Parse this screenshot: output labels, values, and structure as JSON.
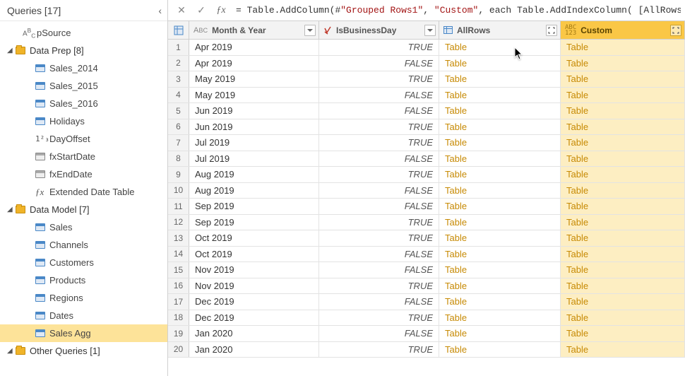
{
  "queries_header": "Queries [17]",
  "tree": {
    "pSource": "pSource",
    "dataPrep": {
      "label": "Data Prep [8]",
      "items": [
        "Sales_2014",
        "Sales_2015",
        "Sales_2016",
        "Holidays",
        "DayOffset",
        "fxStartDate",
        "fxEndDate",
        "Extended Date Table"
      ]
    },
    "dataModel": {
      "label": "Data Model [7]",
      "items": [
        "Sales",
        "Channels",
        "Customers",
        "Products",
        "Regions",
        "Dates",
        "Sales Agg"
      ]
    },
    "otherQueries": {
      "label": "Other Queries [1]"
    }
  },
  "formula": {
    "prefix": "= ",
    "fn1": "Table.AddColumn",
    "open": "(#",
    "arg1": "\"Grouped Rows1\"",
    "sep1": ", ",
    "arg2": "\"Custom\"",
    "sep2": ", ",
    "kw": "each",
    "sp": " ",
    "fn2": "Table.AddIndexColumn",
    "tail": "( [AllRows],"
  },
  "columns": [
    {
      "type": "abc",
      "label": "Month & Year",
      "control": "dd"
    },
    {
      "type": "bool",
      "label": "IsBusinessDay",
      "control": "dd"
    },
    {
      "type": "tbl",
      "label": "AllRows",
      "control": "exp"
    },
    {
      "type": "abc123",
      "label": "Custom",
      "control": "exp",
      "selected": true
    }
  ],
  "rows": [
    {
      "n": 1,
      "my": "Apr 2019",
      "b": "TRUE",
      "a": "Table",
      "c": "Table"
    },
    {
      "n": 2,
      "my": "Apr 2019",
      "b": "FALSE",
      "a": "Table",
      "c": "Table"
    },
    {
      "n": 3,
      "my": "May 2019",
      "b": "TRUE",
      "a": "Table",
      "c": "Table"
    },
    {
      "n": 4,
      "my": "May 2019",
      "b": "FALSE",
      "a": "Table",
      "c": "Table"
    },
    {
      "n": 5,
      "my": "Jun 2019",
      "b": "FALSE",
      "a": "Table",
      "c": "Table"
    },
    {
      "n": 6,
      "my": "Jun 2019",
      "b": "TRUE",
      "a": "Table",
      "c": "Table"
    },
    {
      "n": 7,
      "my": "Jul 2019",
      "b": "TRUE",
      "a": "Table",
      "c": "Table"
    },
    {
      "n": 8,
      "my": "Jul 2019",
      "b": "FALSE",
      "a": "Table",
      "c": "Table"
    },
    {
      "n": 9,
      "my": "Aug 2019",
      "b": "TRUE",
      "a": "Table",
      "c": "Table"
    },
    {
      "n": 10,
      "my": "Aug 2019",
      "b": "FALSE",
      "a": "Table",
      "c": "Table"
    },
    {
      "n": 11,
      "my": "Sep 2019",
      "b": "FALSE",
      "a": "Table",
      "c": "Table"
    },
    {
      "n": 12,
      "my": "Sep 2019",
      "b": "TRUE",
      "a": "Table",
      "c": "Table"
    },
    {
      "n": 13,
      "my": "Oct 2019",
      "b": "TRUE",
      "a": "Table",
      "c": "Table"
    },
    {
      "n": 14,
      "my": "Oct 2019",
      "b": "FALSE",
      "a": "Table",
      "c": "Table"
    },
    {
      "n": 15,
      "my": "Nov 2019",
      "b": "FALSE",
      "a": "Table",
      "c": "Table"
    },
    {
      "n": 16,
      "my": "Nov 2019",
      "b": "TRUE",
      "a": "Table",
      "c": "Table"
    },
    {
      "n": 17,
      "my": "Dec 2019",
      "b": "FALSE",
      "a": "Table",
      "c": "Table"
    },
    {
      "n": 18,
      "my": "Dec 2019",
      "b": "TRUE",
      "a": "Table",
      "c": "Table"
    },
    {
      "n": 19,
      "my": "Jan 2020",
      "b": "FALSE",
      "a": "Table",
      "c": "Table"
    },
    {
      "n": 20,
      "my": "Jan 2020",
      "b": "TRUE",
      "a": "Table",
      "c": "Table"
    }
  ]
}
